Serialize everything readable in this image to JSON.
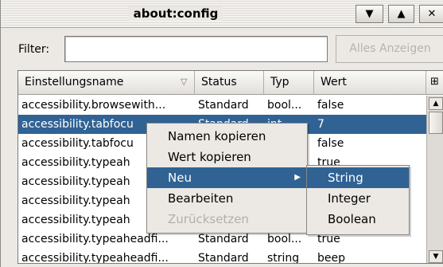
{
  "window": {
    "title": "about:config"
  },
  "titlebar_buttons": [
    {
      "glyph": "▼",
      "name": "menu-button"
    },
    {
      "glyph": "▲",
      "name": "shade-button"
    },
    {
      "glyph": "✕",
      "name": "close-button"
    }
  ],
  "filter": {
    "label": "Filter:",
    "value": "",
    "show_all": "Alles Anzeigen"
  },
  "table": {
    "columns": [
      "Einstellungsname",
      "Status",
      "Typ",
      "Wert"
    ],
    "sort_indicator": "▽",
    "picker_glyph": "⊞",
    "rows": [
      {
        "name": "accessibility.browsewith...",
        "status": "Standard",
        "type": "bool...",
        "value": "false",
        "selected": false
      },
      {
        "name": "accessibility.tabfocu",
        "status": "Standard",
        "type": "int...",
        "value": "7",
        "selected": true
      },
      {
        "name": "accessibility.tabfocu",
        "status": "",
        "type": "",
        "value": "false",
        "selected": false
      },
      {
        "name": "accessibility.typeah",
        "status": "",
        "type": "",
        "value": "true",
        "selected": false
      },
      {
        "name": "accessibility.typeah",
        "status": "",
        "type": "",
        "value": "",
        "selected": false
      },
      {
        "name": "accessibility.typeah",
        "status": "",
        "type": "",
        "value": "",
        "selected": false
      },
      {
        "name": "accessibility.typeah",
        "status": "",
        "type": "",
        "value": "",
        "selected": false
      },
      {
        "name": "accessibility.typeaheadfi...",
        "status": "Standard",
        "type": "bool...",
        "value": "true",
        "selected": false
      },
      {
        "name": "accessibility.typeaheadfi...",
        "status": "Standard",
        "type": "string",
        "value": "beep",
        "selected": false
      }
    ]
  },
  "context_menu": {
    "items": [
      {
        "label": "Namen kopieren",
        "enabled": true,
        "submenu": false,
        "highlighted": false
      },
      {
        "label": "Wert kopieren",
        "enabled": true,
        "submenu": false,
        "highlighted": false
      },
      {
        "label": "Neu",
        "enabled": true,
        "submenu": true,
        "highlighted": true
      },
      {
        "label": "Bearbeiten",
        "enabled": true,
        "submenu": false,
        "highlighted": false
      },
      {
        "label": "Zurücksetzen",
        "enabled": false,
        "submenu": false,
        "highlighted": false
      }
    ],
    "submenu_arrow": "▶"
  },
  "submenu": {
    "items": [
      {
        "label": "String",
        "highlighted": true
      },
      {
        "label": "Integer",
        "highlighted": false
      },
      {
        "label": "Boolean",
        "highlighted": false
      }
    ]
  },
  "colors": {
    "selection": "#306294",
    "background": "#ece9e4"
  }
}
